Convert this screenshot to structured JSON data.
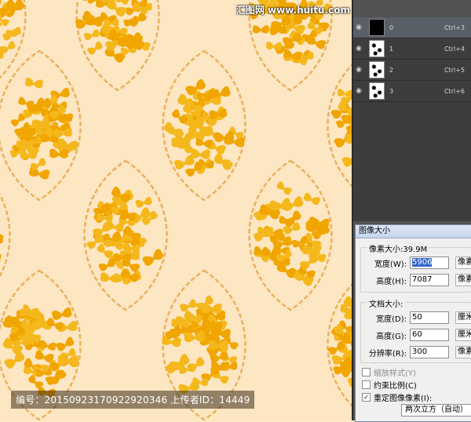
{
  "canvas": {
    "watermark_caption": "编号：20150923170922920346 上传者ID：14449",
    "logo": "汇图网 www.huitu.com",
    "colors": {
      "background": "#fde6c2",
      "butterfly": "#f0a500",
      "vine": "#e9b25e"
    }
  },
  "channels": {
    "rows": [
      {
        "name": "0",
        "shortcut": "Ctrl+3",
        "thumb": "black"
      },
      {
        "name": "1",
        "shortcut": "Ctrl+4",
        "thumb": "pattern"
      },
      {
        "name": "2",
        "shortcut": "Ctrl+5",
        "thumb": "pattern"
      },
      {
        "name": "3",
        "shortcut": "Ctrl+6",
        "thumb": "pattern"
      }
    ]
  },
  "dialog": {
    "title": "图像大小",
    "pixel_size_label": "像素大小:39.9M",
    "width_label": "宽度(W):",
    "width_value": "5906",
    "width_unit": "像素",
    "height_label": "高度(H):",
    "height_value": "7087",
    "height_unit": "像素",
    "doc_size_label": "文档大小:",
    "doc_width_label": "宽度(D):",
    "doc_width_value": "50",
    "doc_width_unit": "厘米",
    "doc_height_label": "高度(G):",
    "doc_height_value": "60",
    "doc_height_unit": "厘米",
    "resolution_label": "分辨率(R):",
    "resolution_value": "300",
    "resolution_unit": "像素/英寸",
    "scale_styles_label": "缩放样式(Y)",
    "constrain_label": "约束比例(C)",
    "resample_label": "重定图像像素(I):",
    "resample_value": "两次立方（自动）"
  }
}
